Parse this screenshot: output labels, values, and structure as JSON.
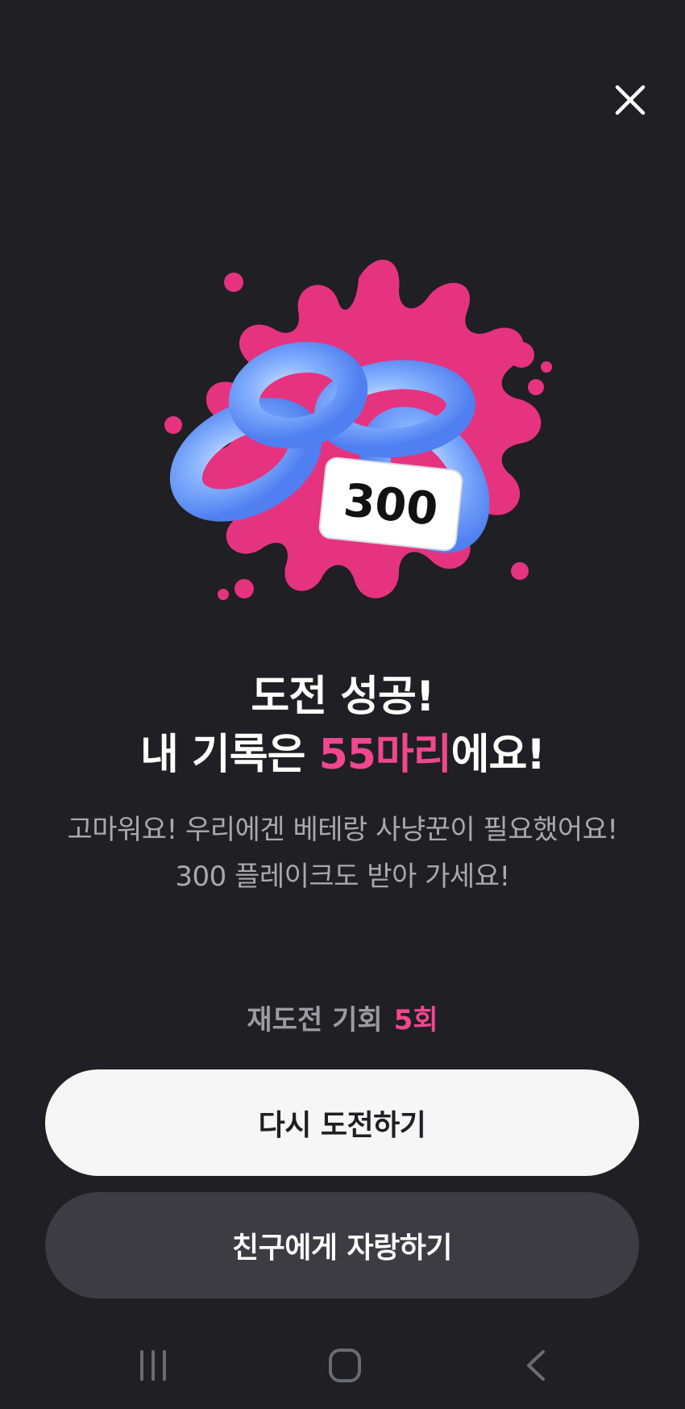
{
  "colors": {
    "background": "#1f1f24",
    "accent": "#f0478e",
    "splash": "#e6337f",
    "ring": "#7eaefd",
    "primary_button": "#f6f6f6",
    "secondary_button": "#3c3c42"
  },
  "header": {
    "close_icon": "close-icon"
  },
  "hero": {
    "badge_value": "300",
    "icon": "blue-rings-splash-illustration"
  },
  "result": {
    "title_line1": "도전 성공!",
    "title_line2_prefix": "내 기록은 ",
    "title_line2_highlight": "55마리",
    "title_line2_suffix": "에요!",
    "message_line1": "고마워요! 우리에겐 베테랑 사냥꾼이 필요했어요!",
    "message_line2": "300 플레이크도 받아 가세요!"
  },
  "retry": {
    "label": "재도전 기회",
    "count": "5회"
  },
  "buttons": {
    "retry_label": "다시 도전하기",
    "share_label": "친구에게 자랑하기"
  },
  "system_nav": {
    "recent_icon": "recent-apps-icon",
    "home_icon": "home-icon",
    "back_icon": "back-icon"
  }
}
